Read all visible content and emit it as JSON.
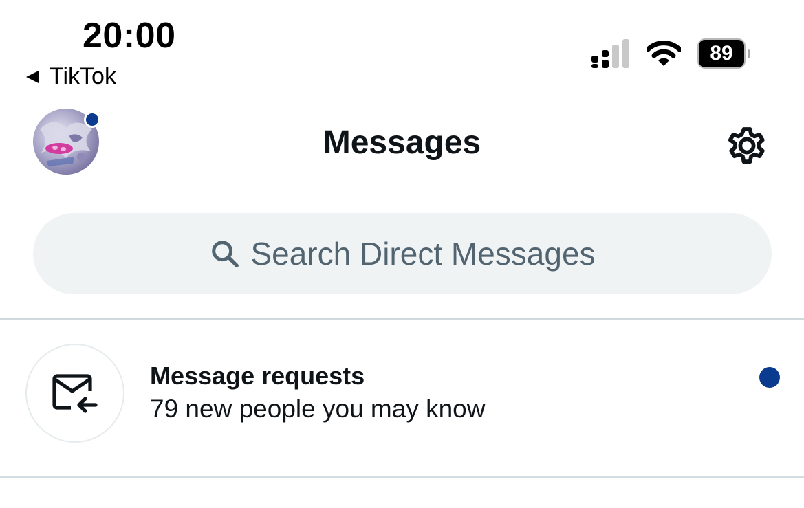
{
  "status_bar": {
    "time": "20:00",
    "back_app": "TikTok",
    "battery_level": "89",
    "signal_icon": "cellular-signal-icon",
    "wifi_icon": "wifi-icon"
  },
  "header": {
    "title": "Messages",
    "avatar_icon": "profile-avatar",
    "settings_icon": "gear-icon",
    "notification_dot_color": "#0b3b8f"
  },
  "search": {
    "placeholder": "Search Direct Messages",
    "icon": "search-icon"
  },
  "message_requests": {
    "title": "Message requests",
    "subtitle": "79 new people you may know",
    "icon": "mail-incoming-icon",
    "unread": true,
    "unread_color": "#0b3b8f"
  },
  "colors": {
    "text_primary": "#0f1419",
    "text_secondary": "#536471",
    "search_bg": "#eff3f4",
    "accent": "#0b3b8f"
  }
}
